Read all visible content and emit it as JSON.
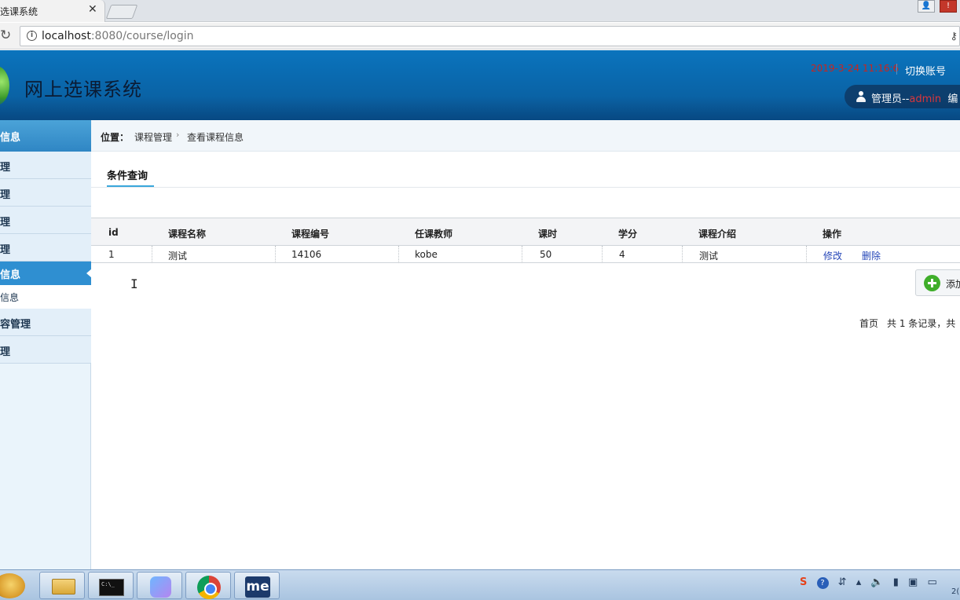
{
  "browser": {
    "tab_title": "选课系统",
    "tab_close": "✕",
    "url_host": "localhost",
    "url_rest": ":8080/course/login"
  },
  "header": {
    "app_title": "网上选课系统",
    "datetime": "2019-3-24 11:16:6",
    "switch_account": "切换账号",
    "user_role": "管理员--",
    "user_name": "admin",
    "user_extra": "编"
  },
  "sidebar": {
    "section_title": "信息",
    "items": [
      {
        "label": "理"
      },
      {
        "label": "理"
      },
      {
        "label": "理"
      },
      {
        "label": "理"
      }
    ],
    "active_item": "信息",
    "sub_item": "信息",
    "items_after": [
      {
        "label": "容管理"
      },
      {
        "label": "理"
      }
    ]
  },
  "breadcrumb": {
    "label": "位置：",
    "level1": "课程管理",
    "separator": "›",
    "level2": "查看课程信息"
  },
  "tabs": {
    "active": "条件查询"
  },
  "table": {
    "columns": [
      "id",
      "课程名称",
      "课程编号",
      "任课教师",
      "课时",
      "学分",
      "课程介绍",
      "操作"
    ],
    "rows": [
      {
        "id": "1",
        "name": "测试",
        "code": "14106",
        "teacher": "kobe",
        "hours": "50",
        "credits": "4",
        "intro": "测试",
        "edit": "修改",
        "delete": "删除"
      }
    ]
  },
  "actions": {
    "add_label": "添加"
  },
  "pager": {
    "first": "首页",
    "summary": "共 1 条记录，共"
  },
  "taskbar": {
    "cmd_text": "C:\\_",
    "me_text": "me",
    "clock_fragment": "2("
  },
  "colors": {
    "header_blue": "#0b74bd",
    "sidebar_active": "#2f8fd1",
    "link_blue": "#2546b8",
    "accent_red": "#c9251f"
  }
}
